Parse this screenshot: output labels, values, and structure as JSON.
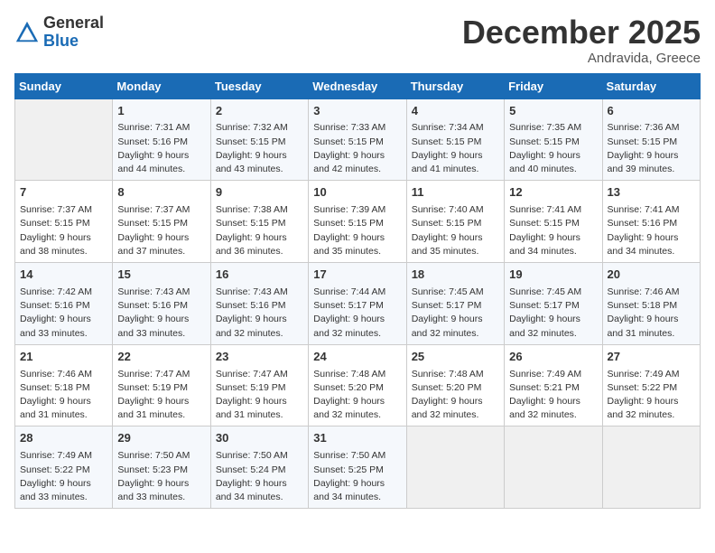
{
  "header": {
    "logo_general": "General",
    "logo_blue": "Blue",
    "month_title": "December 2025",
    "location": "Andravida, Greece"
  },
  "days_of_week": [
    "Sunday",
    "Monday",
    "Tuesday",
    "Wednesday",
    "Thursday",
    "Friday",
    "Saturday"
  ],
  "weeks": [
    [
      {
        "day": "",
        "empty": true
      },
      {
        "day": "1",
        "sunrise": "Sunrise: 7:31 AM",
        "sunset": "Sunset: 5:16 PM",
        "daylight": "Daylight: 9 hours and 44 minutes."
      },
      {
        "day": "2",
        "sunrise": "Sunrise: 7:32 AM",
        "sunset": "Sunset: 5:15 PM",
        "daylight": "Daylight: 9 hours and 43 minutes."
      },
      {
        "day": "3",
        "sunrise": "Sunrise: 7:33 AM",
        "sunset": "Sunset: 5:15 PM",
        "daylight": "Daylight: 9 hours and 42 minutes."
      },
      {
        "day": "4",
        "sunrise": "Sunrise: 7:34 AM",
        "sunset": "Sunset: 5:15 PM",
        "daylight": "Daylight: 9 hours and 41 minutes."
      },
      {
        "day": "5",
        "sunrise": "Sunrise: 7:35 AM",
        "sunset": "Sunset: 5:15 PM",
        "daylight": "Daylight: 9 hours and 40 minutes."
      },
      {
        "day": "6",
        "sunrise": "Sunrise: 7:36 AM",
        "sunset": "Sunset: 5:15 PM",
        "daylight": "Daylight: 9 hours and 39 minutes."
      }
    ],
    [
      {
        "day": "7",
        "sunrise": "Sunrise: 7:37 AM",
        "sunset": "Sunset: 5:15 PM",
        "daylight": "Daylight: 9 hours and 38 minutes."
      },
      {
        "day": "8",
        "sunrise": "Sunrise: 7:37 AM",
        "sunset": "Sunset: 5:15 PM",
        "daylight": "Daylight: 9 hours and 37 minutes."
      },
      {
        "day": "9",
        "sunrise": "Sunrise: 7:38 AM",
        "sunset": "Sunset: 5:15 PM",
        "daylight": "Daylight: 9 hours and 36 minutes."
      },
      {
        "day": "10",
        "sunrise": "Sunrise: 7:39 AM",
        "sunset": "Sunset: 5:15 PM",
        "daylight": "Daylight: 9 hours and 35 minutes."
      },
      {
        "day": "11",
        "sunrise": "Sunrise: 7:40 AM",
        "sunset": "Sunset: 5:15 PM",
        "daylight": "Daylight: 9 hours and 35 minutes."
      },
      {
        "day": "12",
        "sunrise": "Sunrise: 7:41 AM",
        "sunset": "Sunset: 5:15 PM",
        "daylight": "Daylight: 9 hours and 34 minutes."
      },
      {
        "day": "13",
        "sunrise": "Sunrise: 7:41 AM",
        "sunset": "Sunset: 5:16 PM",
        "daylight": "Daylight: 9 hours and 34 minutes."
      }
    ],
    [
      {
        "day": "14",
        "sunrise": "Sunrise: 7:42 AM",
        "sunset": "Sunset: 5:16 PM",
        "daylight": "Daylight: 9 hours and 33 minutes."
      },
      {
        "day": "15",
        "sunrise": "Sunrise: 7:43 AM",
        "sunset": "Sunset: 5:16 PM",
        "daylight": "Daylight: 9 hours and 33 minutes."
      },
      {
        "day": "16",
        "sunrise": "Sunrise: 7:43 AM",
        "sunset": "Sunset: 5:16 PM",
        "daylight": "Daylight: 9 hours and 32 minutes."
      },
      {
        "day": "17",
        "sunrise": "Sunrise: 7:44 AM",
        "sunset": "Sunset: 5:17 PM",
        "daylight": "Daylight: 9 hours and 32 minutes."
      },
      {
        "day": "18",
        "sunrise": "Sunrise: 7:45 AM",
        "sunset": "Sunset: 5:17 PM",
        "daylight": "Daylight: 9 hours and 32 minutes."
      },
      {
        "day": "19",
        "sunrise": "Sunrise: 7:45 AM",
        "sunset": "Sunset: 5:17 PM",
        "daylight": "Daylight: 9 hours and 32 minutes."
      },
      {
        "day": "20",
        "sunrise": "Sunrise: 7:46 AM",
        "sunset": "Sunset: 5:18 PM",
        "daylight": "Daylight: 9 hours and 31 minutes."
      }
    ],
    [
      {
        "day": "21",
        "sunrise": "Sunrise: 7:46 AM",
        "sunset": "Sunset: 5:18 PM",
        "daylight": "Daylight: 9 hours and 31 minutes."
      },
      {
        "day": "22",
        "sunrise": "Sunrise: 7:47 AM",
        "sunset": "Sunset: 5:19 PM",
        "daylight": "Daylight: 9 hours and 31 minutes."
      },
      {
        "day": "23",
        "sunrise": "Sunrise: 7:47 AM",
        "sunset": "Sunset: 5:19 PM",
        "daylight": "Daylight: 9 hours and 31 minutes."
      },
      {
        "day": "24",
        "sunrise": "Sunrise: 7:48 AM",
        "sunset": "Sunset: 5:20 PM",
        "daylight": "Daylight: 9 hours and 32 minutes."
      },
      {
        "day": "25",
        "sunrise": "Sunrise: 7:48 AM",
        "sunset": "Sunset: 5:20 PM",
        "daylight": "Daylight: 9 hours and 32 minutes."
      },
      {
        "day": "26",
        "sunrise": "Sunrise: 7:49 AM",
        "sunset": "Sunset: 5:21 PM",
        "daylight": "Daylight: 9 hours and 32 minutes."
      },
      {
        "day": "27",
        "sunrise": "Sunrise: 7:49 AM",
        "sunset": "Sunset: 5:22 PM",
        "daylight": "Daylight: 9 hours and 32 minutes."
      }
    ],
    [
      {
        "day": "28",
        "sunrise": "Sunrise: 7:49 AM",
        "sunset": "Sunset: 5:22 PM",
        "daylight": "Daylight: 9 hours and 33 minutes."
      },
      {
        "day": "29",
        "sunrise": "Sunrise: 7:50 AM",
        "sunset": "Sunset: 5:23 PM",
        "daylight": "Daylight: 9 hours and 33 minutes."
      },
      {
        "day": "30",
        "sunrise": "Sunrise: 7:50 AM",
        "sunset": "Sunset: 5:24 PM",
        "daylight": "Daylight: 9 hours and 34 minutes."
      },
      {
        "day": "31",
        "sunrise": "Sunrise: 7:50 AM",
        "sunset": "Sunset: 5:25 PM",
        "daylight": "Daylight: 9 hours and 34 minutes."
      },
      {
        "day": "",
        "empty": true
      },
      {
        "day": "",
        "empty": true
      },
      {
        "day": "",
        "empty": true
      }
    ]
  ]
}
